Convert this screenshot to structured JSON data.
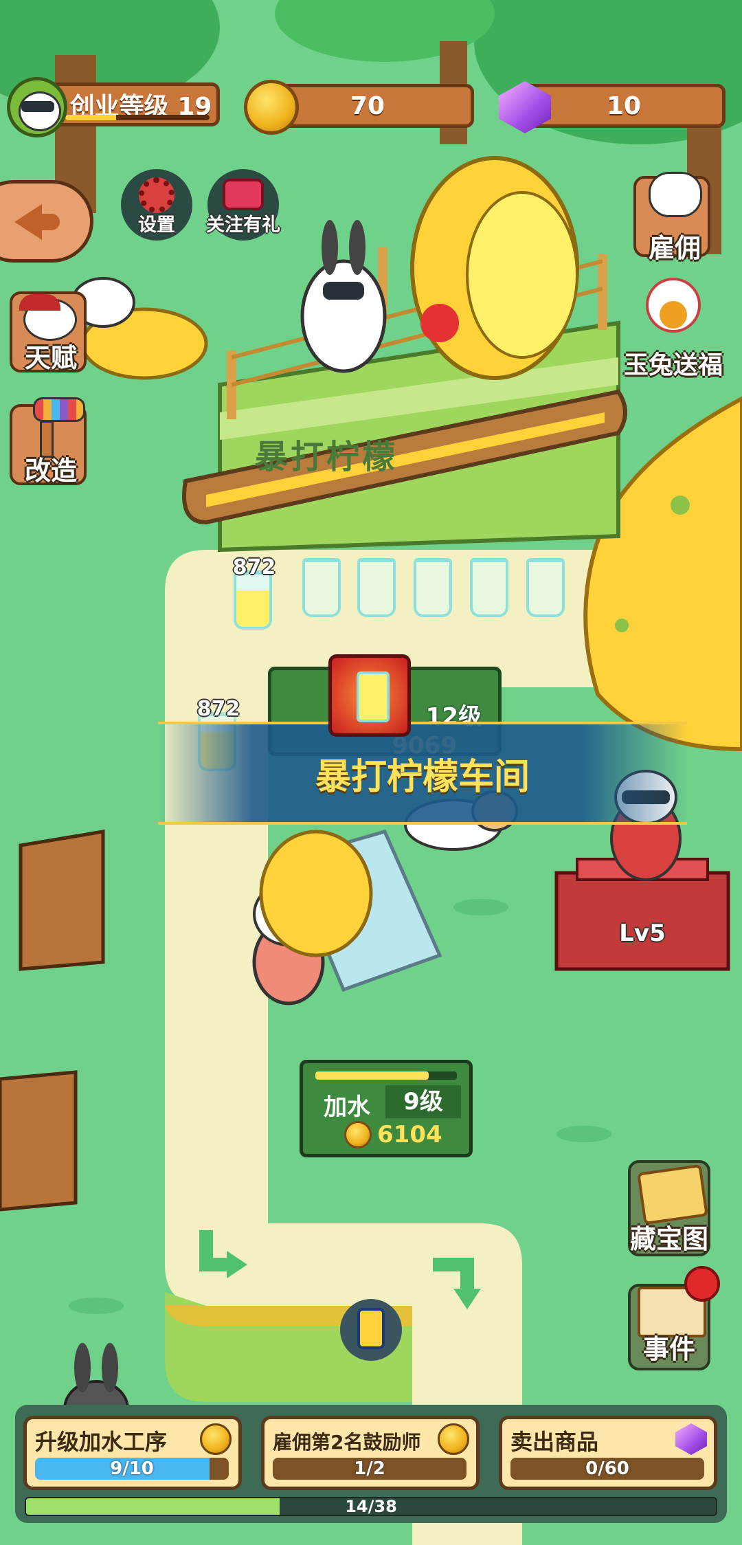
{
  "hud": {
    "level_label": "创业等级 19",
    "level_progress": 0.35,
    "coins": "70",
    "gems": "10"
  },
  "top_buttons": {
    "settings": "设置",
    "follow_gift": "关注有礼"
  },
  "side_left": {
    "talent": "天赋",
    "upgrade": "改造"
  },
  "side_right": {
    "hire": "雇佣",
    "rabbit_blessing": "玉兔送福",
    "treasure_map": "藏宝图",
    "events": "事件"
  },
  "stations": {
    "sign_text": "暴打柠檬",
    "glass_count_1": "872",
    "glass_count_2": "872",
    "workshop_banner": "暴打柠檬车间",
    "workshop_level": "12级",
    "workshop_cost": "9069",
    "water_station_name": "加水",
    "water_station_level": "9级",
    "water_station_cost": "6104",
    "chair_level": "Lv5"
  },
  "tasks": [
    {
      "title": "升级加水工序",
      "progress_text": "9/10",
      "progress": 0.9,
      "icon": "coin-icon"
    },
    {
      "title": "雇佣第2名鼓励师",
      "progress_text": "1/2",
      "progress": 0.0,
      "icon": "coin-icon"
    },
    {
      "title": "卖出商品",
      "progress_text": "0/60",
      "progress": 0.0,
      "icon": "gem-icon"
    }
  ],
  "overall": {
    "progress_text": "14/38",
    "progress": 0.368
  },
  "colors": {
    "grass": "#6fd18a",
    "path": "#f3f0c2",
    "wood": "#c8763a",
    "lemon": "#ffd23a",
    "progress_blue": "#4ab8f0"
  }
}
